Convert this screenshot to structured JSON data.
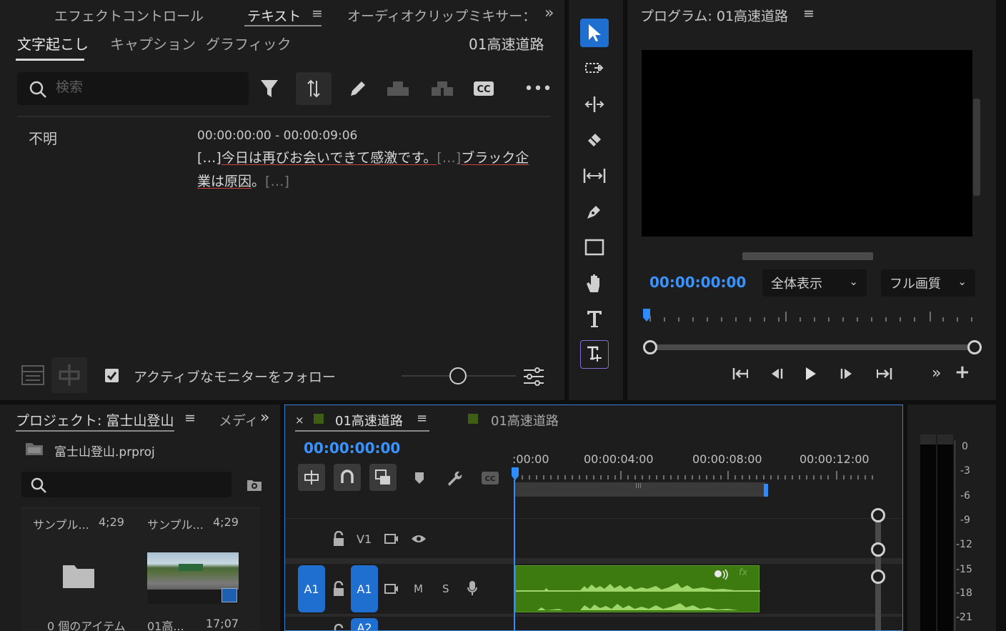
{
  "text_panel": {
    "tabs": [
      "エフェクトコントロール",
      "テキスト",
      "オーディオクリップミキサー：",
      "»"
    ],
    "active_tab": "テキスト",
    "subtabs": [
      "文字起こし",
      "キャプション",
      "グラフィック"
    ],
    "sequence_name": "01高速道路",
    "search_placeholder": "検索",
    "speaker": "不明",
    "timecode_range": "00:00:00:00 - 00:00:09:06",
    "transcript": {
      "gap_marker": "[…]",
      "line1_part1": "今日は再びお会いできて感激です。",
      "line1_part2": "ブラック企",
      "line2_part1": "業は原因",
      "line2_punct": "。"
    },
    "follow_monitor_label": "アクティブなモニターをフォロー",
    "follow_monitor_checked": true
  },
  "program_monitor": {
    "title": "プログラム: 01高速道路",
    "timecode": "00:00:00:00",
    "fit_select": "全体表示",
    "quality_select": "フル画質"
  },
  "project_panel": {
    "title": "プロジェクト: 富士山登山",
    "next_tab": "メディ",
    "file_name": "富士山登山.prproj",
    "items": [
      {
        "name": "サンプル...",
        "duration": "4;29",
        "footer_name": "0 個のアイテム",
        "footer_duration": ""
      },
      {
        "name": "サンプル...",
        "duration": "4;29",
        "footer_name": "01高...",
        "footer_duration": "17;07"
      }
    ]
  },
  "timeline": {
    "tab1": "01高速道路",
    "tab2": "01高速道路",
    "close_glyph": "×",
    "timecode": "00:00:00:00",
    "ruler_labels": [
      ":00:00",
      "00:00:04:00",
      "00:00:08:00",
      "00:00:12:00"
    ],
    "tracks": {
      "v1_label": "V1",
      "a1_source": "A1",
      "a1_label": "A1",
      "mute": "M",
      "solo": "S",
      "a2_label": "A2"
    },
    "clip_fx": "fx"
  },
  "audio_meter": {
    "db_labels": [
      "0",
      "-3",
      "-6",
      "-9",
      "-12",
      "-15",
      "-18",
      "-21"
    ]
  },
  "colors": {
    "accent_blue": "#2f8cff",
    "clip_green": "#3d7a10",
    "waveform_green": "#9fd66a",
    "underline_red": "#d04040",
    "timecode_blue": "#3a93ff"
  }
}
